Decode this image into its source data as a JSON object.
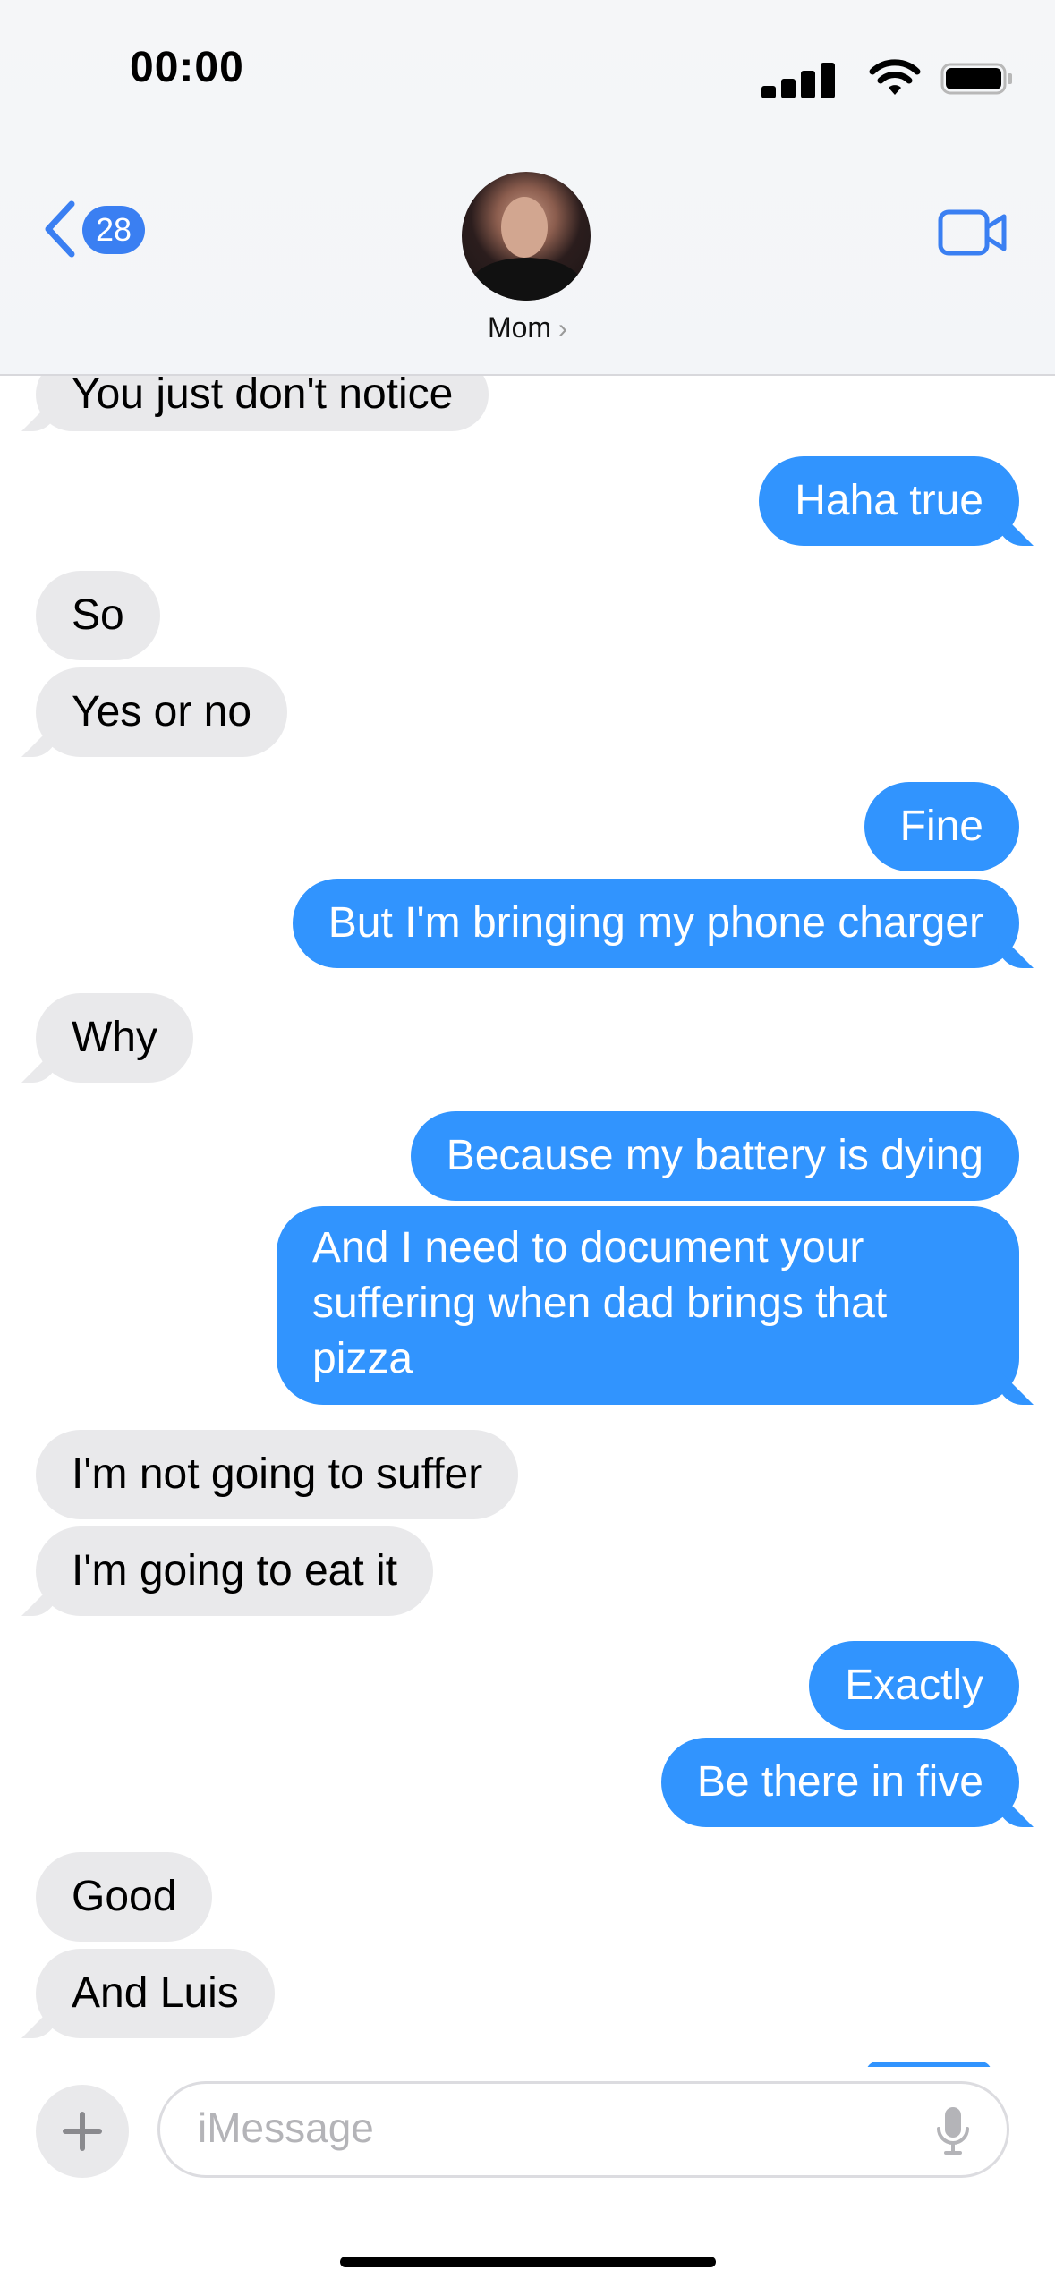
{
  "status_bar": {
    "time": "00:00"
  },
  "header": {
    "back_badge": "28",
    "contact_name": "Mom",
    "contact_arrow": "›"
  },
  "messages": [
    {
      "text": "You just don't notice",
      "from": "them"
    },
    {
      "text": "Haha true",
      "from": "me"
    },
    {
      "text": "So",
      "from": "them"
    },
    {
      "text": "Yes or no",
      "from": "them"
    },
    {
      "text": "Fine",
      "from": "me"
    },
    {
      "text": "But I'm bringing my phone charger",
      "from": "me"
    },
    {
      "text": "Why",
      "from": "them"
    },
    {
      "text": "Because my battery is dying",
      "from": "me"
    },
    {
      "text": "And I need to document your suffering when dad brings that pizza",
      "from": "me"
    },
    {
      "text": "I'm not going to suffer",
      "from": "them"
    },
    {
      "text": "I'm going to eat it",
      "from": "them"
    },
    {
      "text": "Exactly",
      "from": "me"
    },
    {
      "text": "Be there in five",
      "from": "me"
    },
    {
      "text": "Good",
      "from": "them"
    },
    {
      "text": "And Luis",
      "from": "them"
    }
  ],
  "composer": {
    "placeholder": "iMessage"
  },
  "colors": {
    "accent": "#3a7ff2",
    "outgoing": "#3194fe",
    "incoming": "#e9e9eb"
  }
}
